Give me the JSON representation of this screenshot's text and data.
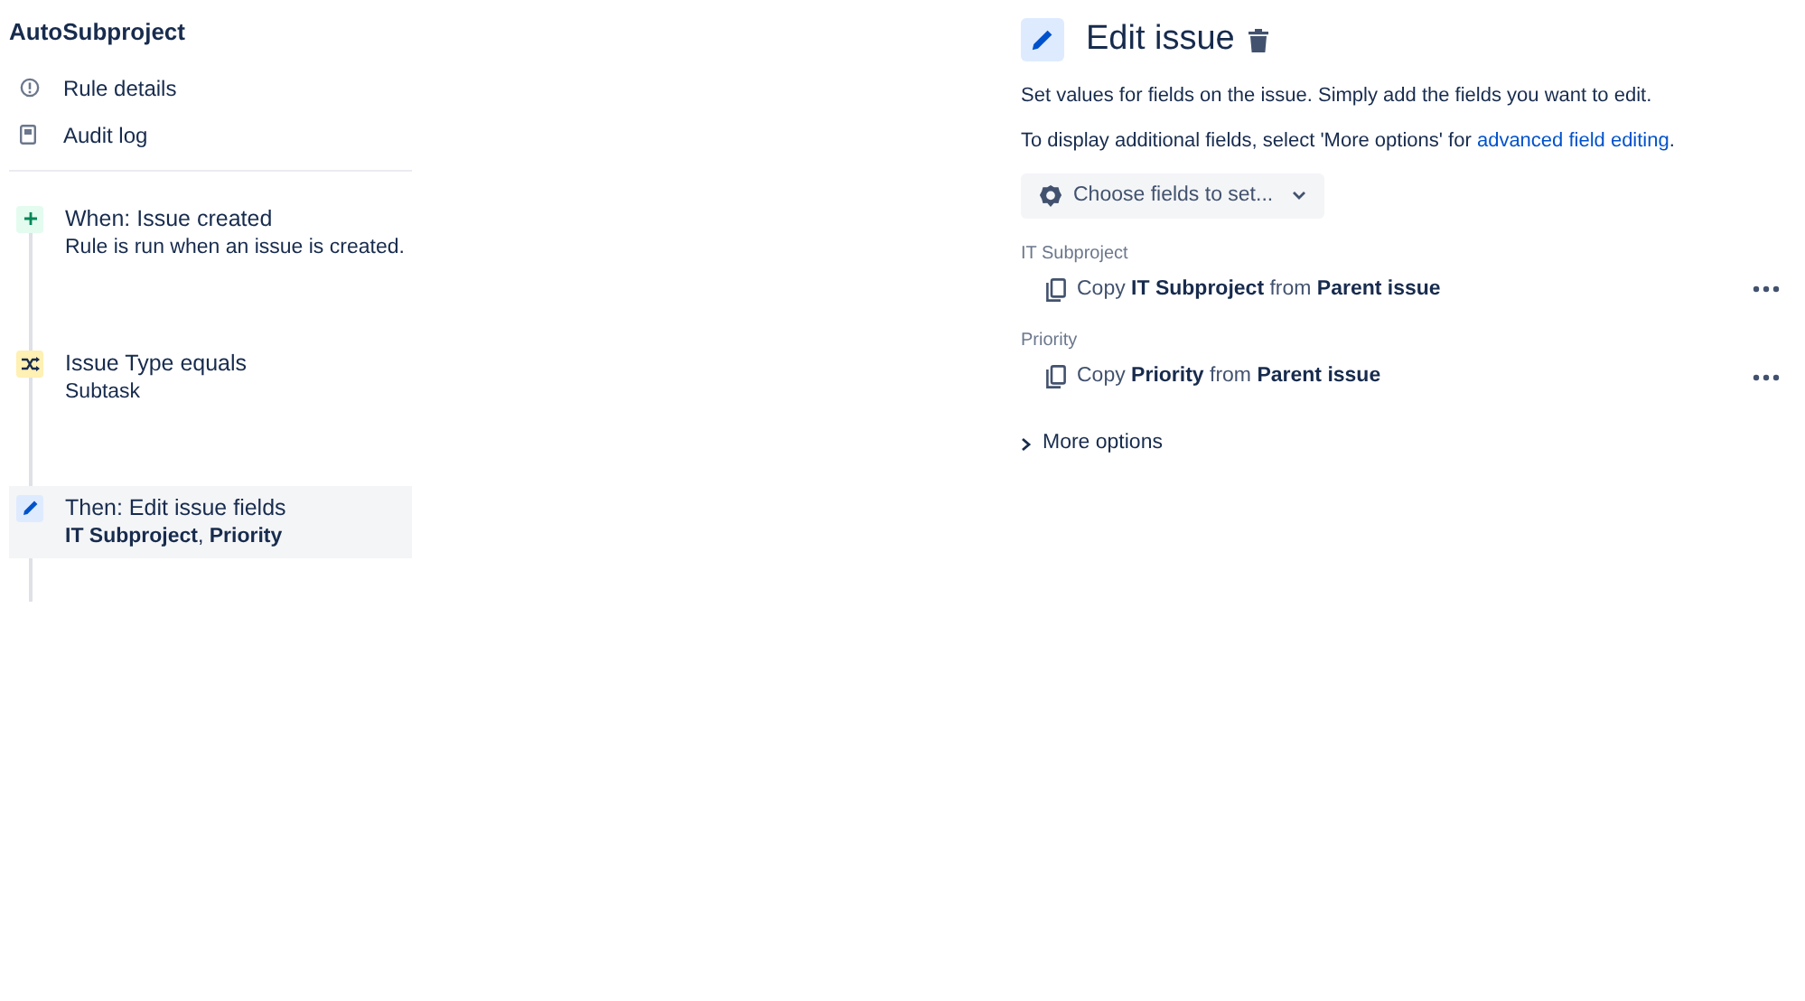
{
  "rule": {
    "title": "AutoSubproject"
  },
  "nav": [
    {
      "label": "Rule details"
    },
    {
      "label": "Audit log"
    }
  ],
  "steps": [
    {
      "kind": "trigger",
      "title": "When: Issue created",
      "detail": "Rule is run when an issue is created.",
      "selected": false
    },
    {
      "kind": "condition",
      "title": "Issue Type equals",
      "detail": "Subtask",
      "selected": false
    },
    {
      "kind": "action",
      "title": "Then: Edit issue fields",
      "detail": "**IT Subproject**, **Priority**",
      "selected": true
    }
  ],
  "panel": {
    "title": "Edit issue",
    "description": "Set values for fields on the issue. Simply add the fields you want to edit.",
    "hint": "To display additional fields, select 'More options' for",
    "hint_link": "advanced field editing",
    "hint_end": ".",
    "choose_button": "Choose fields to set...",
    "fields": [
      {
        "label": "IT Subproject",
        "value": "Copy **IT Subproject** from **Parent issue**"
      },
      {
        "label": "Priority",
        "value": "Copy **Priority** from **Parent issue**"
      }
    ],
    "more_options": {
      "label": "More options",
      "expanded": false
    }
  }
}
